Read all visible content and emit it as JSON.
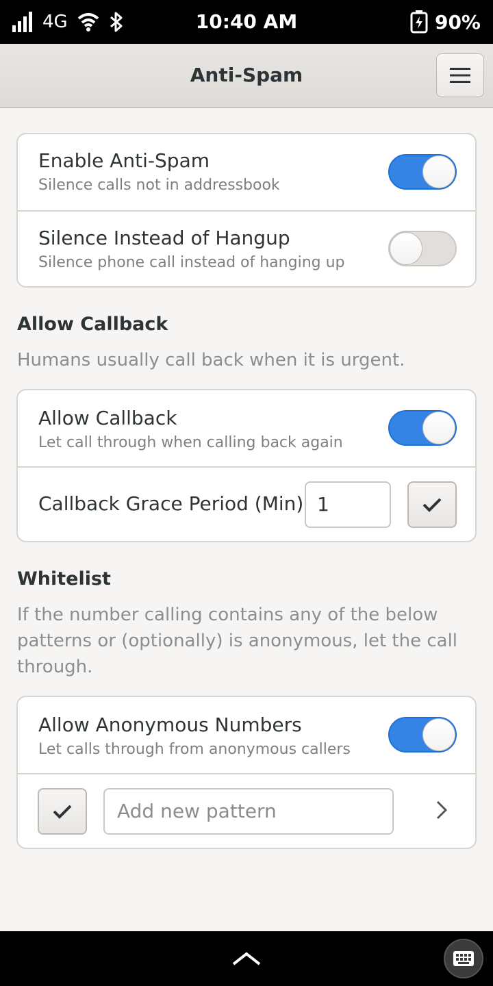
{
  "status_bar": {
    "network": "4G",
    "time": "10:40 AM",
    "battery": "90%"
  },
  "header": {
    "title": "Anti-Spam"
  },
  "main_card": {
    "rows": [
      {
        "title": "Enable Anti-Spam",
        "subtitle": "Silence calls not in addressbook",
        "enabled": true
      },
      {
        "title": "Silence Instead of Hangup",
        "subtitle": "Silence phone call instead of hanging up",
        "enabled": false
      }
    ]
  },
  "callback_section": {
    "title": "Allow Callback",
    "description": "Humans usually call back when it is urgent.",
    "allow_row": {
      "title": "Allow Callback",
      "subtitle": "Let call through when calling back again",
      "enabled": true
    },
    "grace_row": {
      "label": "Callback Grace Period (Min)",
      "value": "1"
    }
  },
  "whitelist_section": {
    "title": "Whitelist",
    "description": "If the number calling contains any of the below patterns or (optionally) is anonymous, let the call through.",
    "anonymous_row": {
      "title": "Allow Anonymous Numbers",
      "subtitle": "Let calls through from anonymous callers",
      "enabled": true
    },
    "pattern_row": {
      "placeholder": "Add new pattern"
    }
  },
  "colors": {
    "accent": "#3584e4",
    "background": "#f6f5f4",
    "header": "#e8e6e3"
  }
}
